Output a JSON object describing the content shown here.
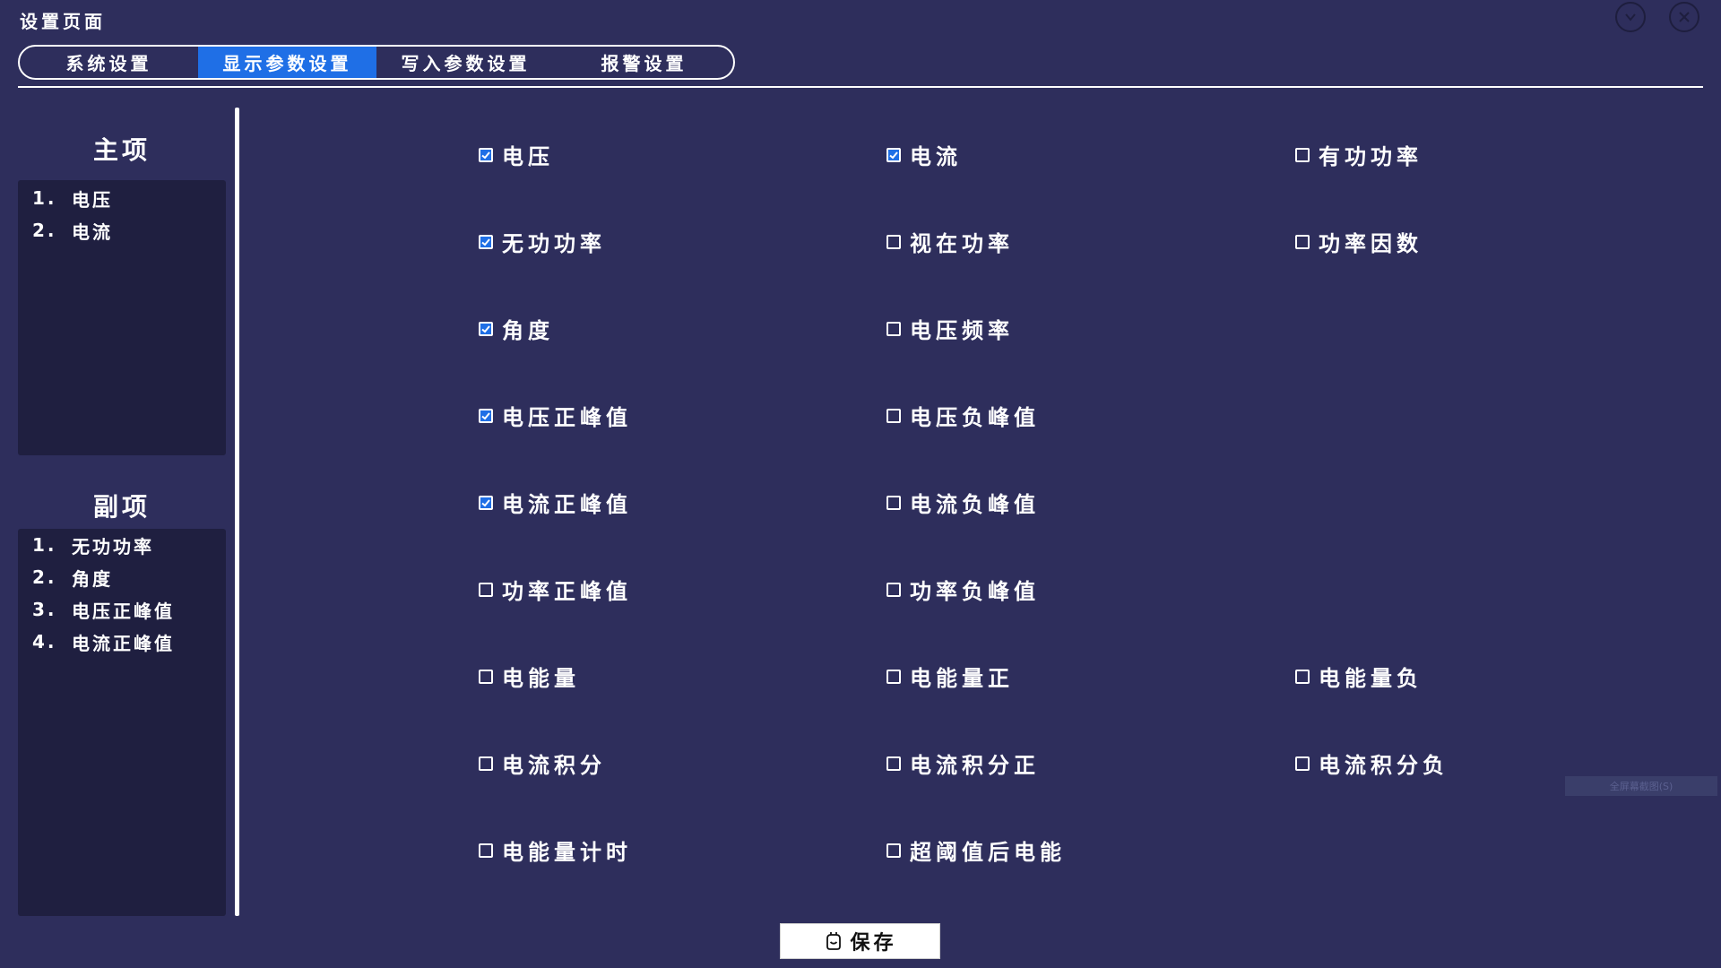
{
  "window": {
    "title": "设置页面",
    "minimize_icon": "chevron-down-circle-icon",
    "close_icon": "close-circle-icon"
  },
  "tabs": [
    {
      "label": "系统设置",
      "active": false
    },
    {
      "label": "显示参数设置",
      "active": true
    },
    {
      "label": "写入参数设置",
      "active": false
    },
    {
      "label": "报警设置",
      "active": false
    }
  ],
  "sidebar": {
    "main": {
      "title": "主项",
      "items": [
        {
          "num": "1.",
          "label": "电压"
        },
        {
          "num": "2.",
          "label": "电流"
        }
      ]
    },
    "secondary": {
      "title": "副项",
      "items": [
        {
          "num": "1.",
          "label": "无功功率"
        },
        {
          "num": "2.",
          "label": "角度"
        },
        {
          "num": "3.",
          "label": "电压正峰值"
        },
        {
          "num": "4.",
          "label": "电流正峰值"
        }
      ]
    }
  },
  "options": [
    {
      "label": "电压",
      "checked": true
    },
    {
      "label": "电流",
      "checked": true
    },
    {
      "label": "有功功率",
      "checked": false
    },
    {
      "label": "无功功率",
      "checked": true
    },
    {
      "label": "视在功率",
      "checked": false
    },
    {
      "label": "功率因数",
      "checked": false
    },
    {
      "label": "角度",
      "checked": true
    },
    {
      "label": "电压频率",
      "checked": false
    },
    {
      "label": "电压正峰值",
      "checked": true
    },
    {
      "label": "电压负峰值",
      "checked": false
    },
    {
      "label": "电流正峰值",
      "checked": true
    },
    {
      "label": "电流负峰值",
      "checked": false
    },
    {
      "label": "功率正峰值",
      "checked": false
    },
    {
      "label": "功率负峰值",
      "checked": false
    },
    {
      "label": "电能量",
      "checked": false
    },
    {
      "label": "电能量正",
      "checked": false
    },
    {
      "label": "电能量负",
      "checked": false
    },
    {
      "label": "电流积分",
      "checked": false
    },
    {
      "label": "电流积分正",
      "checked": false
    },
    {
      "label": "电流积分负",
      "checked": false
    },
    {
      "label": "电能量计时",
      "checked": false
    },
    {
      "label": "超阈值后电能",
      "checked": false
    }
  ],
  "save": {
    "label": "保存",
    "icon": "save-icon"
  },
  "hint": "全屏幕截图(S)",
  "colors": {
    "background": "#2e2e5c",
    "panel": "#1f1f40",
    "accent": "#1f6fe6",
    "text": "#ffffff"
  }
}
